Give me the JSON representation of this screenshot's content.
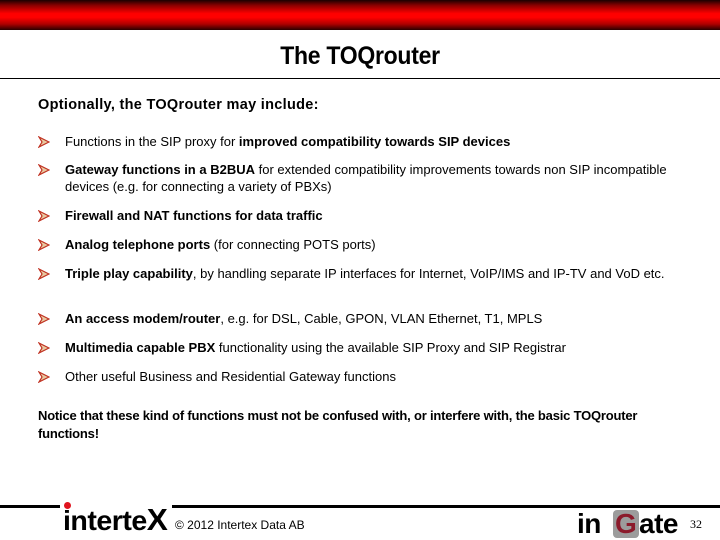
{
  "slide": {
    "title": "The TOQrouter",
    "intro": "Optionally, the TOQrouter may include:",
    "bullet_icon": "arrowhead-bullet-icon",
    "accent_color": "#ff0000",
    "bullets": [
      {
        "bold": "",
        "text": "Functions in the SIP proxy for ",
        "bold2": "improved compatibility towards SIP devices",
        "text2": ""
      },
      {
        "bold": "Gateway functions in a B2BUA",
        "text": " for extended compatibility improvements towards non SIP incompatible devices (e.g. for connecting a variety of PBXs)",
        "bold2": "",
        "text2": ""
      },
      {
        "bold": "Firewall and NAT functions for data traffic",
        "text": "",
        "bold2": "",
        "text2": ""
      },
      {
        "bold": "Analog telephone ports",
        "text": " (for connecting POTS ports)",
        "bold2": "",
        "text2": ""
      },
      {
        "bold": "Triple play capability",
        "text": ", by handling separate IP interfaces for Internet, VoIP/IMS and IP-TV and VoD etc.",
        "bold2": "",
        "text2": ""
      },
      {
        "bold": "An access modem/router",
        "text": ", e.g. for DSL, Cable, GPON, VLAN Ethernet, T1, MPLS",
        "bold2": "",
        "text2": ""
      },
      {
        "bold": "Multimedia capable PBX",
        "text": " functionality using the available SIP Proxy and SIP Registrar",
        "bold2": "",
        "text2": ""
      },
      {
        "bold": "",
        "text": "Other useful Business and Residential Gateway functions",
        "bold2": "",
        "text2": ""
      }
    ],
    "notice": "Notice that these kind of functions must not be confused with, or interfere with, the basic TOQrouter functions!"
  },
  "footer": {
    "left_logo": "intertex",
    "left_logo_parts": {
      "main": "interte",
      "x": "X"
    },
    "copyright": "© 2012 Intertex Data AB",
    "right_logo_parts": {
      "pre": "in",
      "g": "G",
      "post": "ate"
    },
    "page_number": "32"
  }
}
